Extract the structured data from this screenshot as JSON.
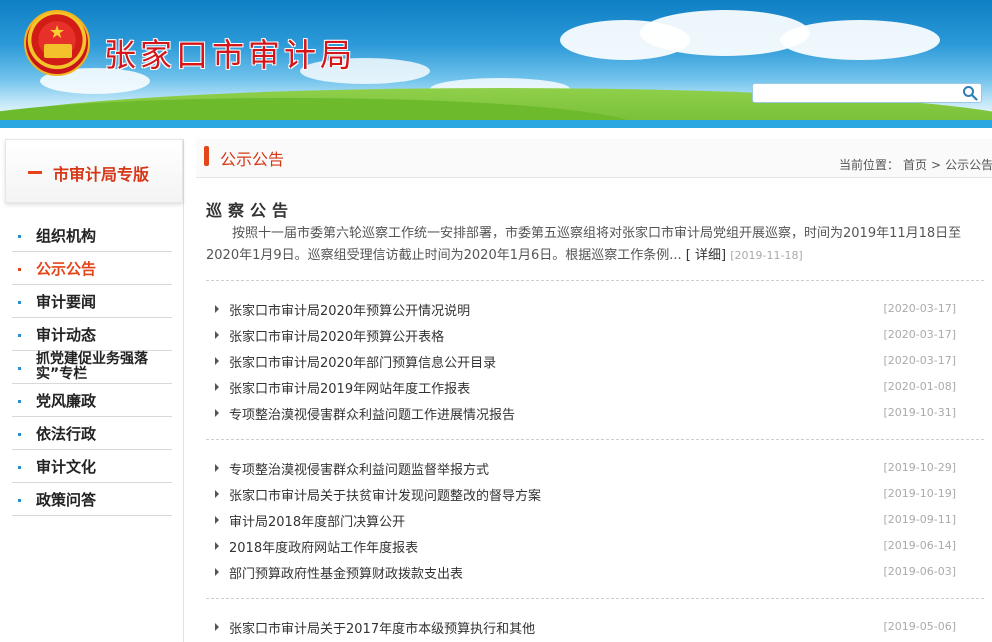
{
  "header": {
    "site_title": "张家口市审计局",
    "search_placeholder": "",
    "search_icon": "search-icon"
  },
  "sidebar": {
    "title": "市审计局专版",
    "items": [
      {
        "label": "组织机构",
        "active": false
      },
      {
        "label": "公示公告",
        "active": true
      },
      {
        "label": "审计要闻",
        "active": false
      },
      {
        "label": "审计动态",
        "active": false
      },
      {
        "label": "抓党建促业务强落实”专栏",
        "active": false
      },
      {
        "label": "党风廉政",
        "active": false
      },
      {
        "label": "依法行政",
        "active": false
      },
      {
        "label": "审计文化",
        "active": false
      },
      {
        "label": "政策问答",
        "active": false
      }
    ]
  },
  "main": {
    "section_title": "公示公告",
    "breadcrumb": {
      "prefix": "当前位置：",
      "home": "首页",
      "sep": ">",
      "current": "公示公告"
    },
    "notice": {
      "title": "巡察公告",
      "body": "按照十一届市委第六轮巡察工作统一安排部署，市委第五巡察组将对张家口市审计局党组开展巡察，时间为2019年11月18日至2020年1月9日。巡察组受理信访截止时间为2020年1月6日。根据巡察工作条例... ",
      "more": "[ 详细]",
      "date": "[2019-11-18]"
    },
    "groups": [
      [
        {
          "title": "张家口市审计局2020年预算公开情况说明",
          "date": "[2020-03-17]"
        },
        {
          "title": "张家口市审计局2020年预算公开表格",
          "date": "[2020-03-17]"
        },
        {
          "title": "张家口市审计局2020年部门预算信息公开目录",
          "date": "[2020-03-17]"
        },
        {
          "title": "张家口市审计局2019年网站年度工作报表",
          "date": "[2020-01-08]"
        },
        {
          "title": "专项整治漠视侵害群众利益问题工作进展情况报告",
          "date": "[2019-10-31]"
        }
      ],
      [
        {
          "title": "专项整治漠视侵害群众利益问题监督举报方式",
          "date": "[2019-10-29]"
        },
        {
          "title": "张家口市审计局关于扶贫审计发现问题整改的督导方案",
          "date": "[2019-10-19]"
        },
        {
          "title": "审计局2018年度部门决算公开",
          "date": "[2019-09-11]"
        },
        {
          "title": "2018年度政府网站工作年度报表",
          "date": "[2019-06-14]"
        },
        {
          "title": "部门预算政府性基金预算财政拨款支出表",
          "date": "[2019-06-03]"
        }
      ],
      [
        {
          "title": "张家口市审计局关于2017年度市本级预算执行和其他",
          "date": "[2019-05-06]"
        }
      ]
    ]
  }
}
